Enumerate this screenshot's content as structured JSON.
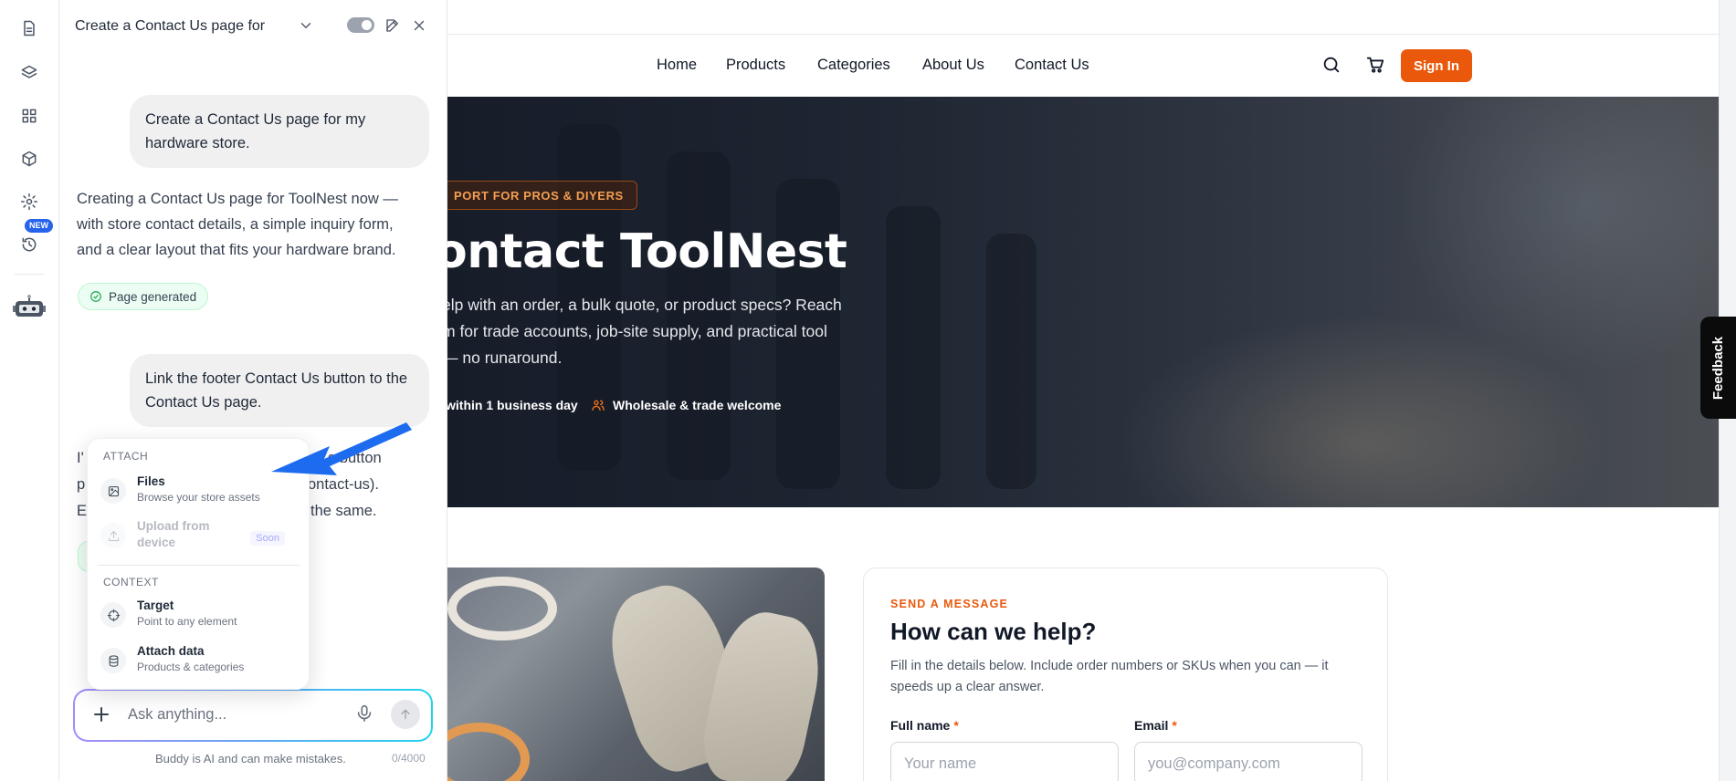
{
  "panel": {
    "title": "Create a Contact Us page for ..."
  },
  "chat": {
    "messages": [
      {
        "role": "user",
        "text": "Create a Contact Us page for my hardware store."
      },
      {
        "role": "assistant",
        "text": "Creating a Contact Us page for ToolNest now — with store contact details, a simple inquiry form, and a clear layout that fits your hardware brand."
      },
      {
        "role": "status",
        "text": "Page generated"
      },
      {
        "role": "user",
        "text": "Link the footer Contact Us button to the Contact Us page."
      },
      {
        "role": "assistant_partial",
        "lines": [
          "I'",
          "s button",
          "p",
          "ontact-us).",
          "E",
          "the same."
        ]
      }
    ]
  },
  "attach_menu": {
    "section_attach": "ATTACH",
    "section_context": "CONTEXT",
    "items": [
      {
        "title": "Files",
        "subtitle": "Browse your store assets",
        "icon": "image-icon",
        "enabled": true
      },
      {
        "title": "Upload from device",
        "subtitle": "",
        "icon": "upload-icon",
        "enabled": false,
        "badge": "Soon"
      },
      {
        "title": "Target",
        "subtitle": "Point to any element",
        "icon": "crosshair-icon",
        "enabled": true
      },
      {
        "title": "Attach data",
        "subtitle": "Products & categories",
        "icon": "database-icon",
        "enabled": true
      }
    ]
  },
  "input": {
    "placeholder": "Ask anything...",
    "value": "",
    "disclaimer": "Buddy is AI and can make mistakes.",
    "counter": "0/4000"
  },
  "rail": {
    "new_badge": "NEW",
    "icons": [
      "page-icon",
      "layers-icon",
      "grid-icon",
      "cube-icon",
      "gear-icon",
      "history-icon",
      "robot-icon"
    ]
  },
  "site": {
    "nav": [
      "Home",
      "Products",
      "Categories",
      "About Us",
      "Contact Us"
    ],
    "signin": "Sign In",
    "hero": {
      "tag": "PORT FOR PROS & DIYERS",
      "title": "ontact ToolNest",
      "subtitle_lines": [
        "elp with an order, a bulk quote, or product specs? Reach",
        "m for trade accounts, job-site supply, and practical tool",
        "— no runaround."
      ],
      "meta1": "within 1 business day",
      "meta2": "Wholesale & trade welcome"
    },
    "form": {
      "eyebrow": "SEND A MESSAGE",
      "title": "How can we help?",
      "desc": "Fill in the details below. Include order numbers or SKUs when you can — it speeds up a clear answer.",
      "fullname_label": "Full name",
      "email_label": "Email",
      "required_mark": "*",
      "fullname_placeholder": "Your name",
      "email_placeholder": "you@company.com"
    },
    "feedback": "Feedback"
  },
  "colors": {
    "accent": "#ea580c",
    "brand_blue": "#2563eb",
    "arrow_blue": "#1d6cf0"
  }
}
